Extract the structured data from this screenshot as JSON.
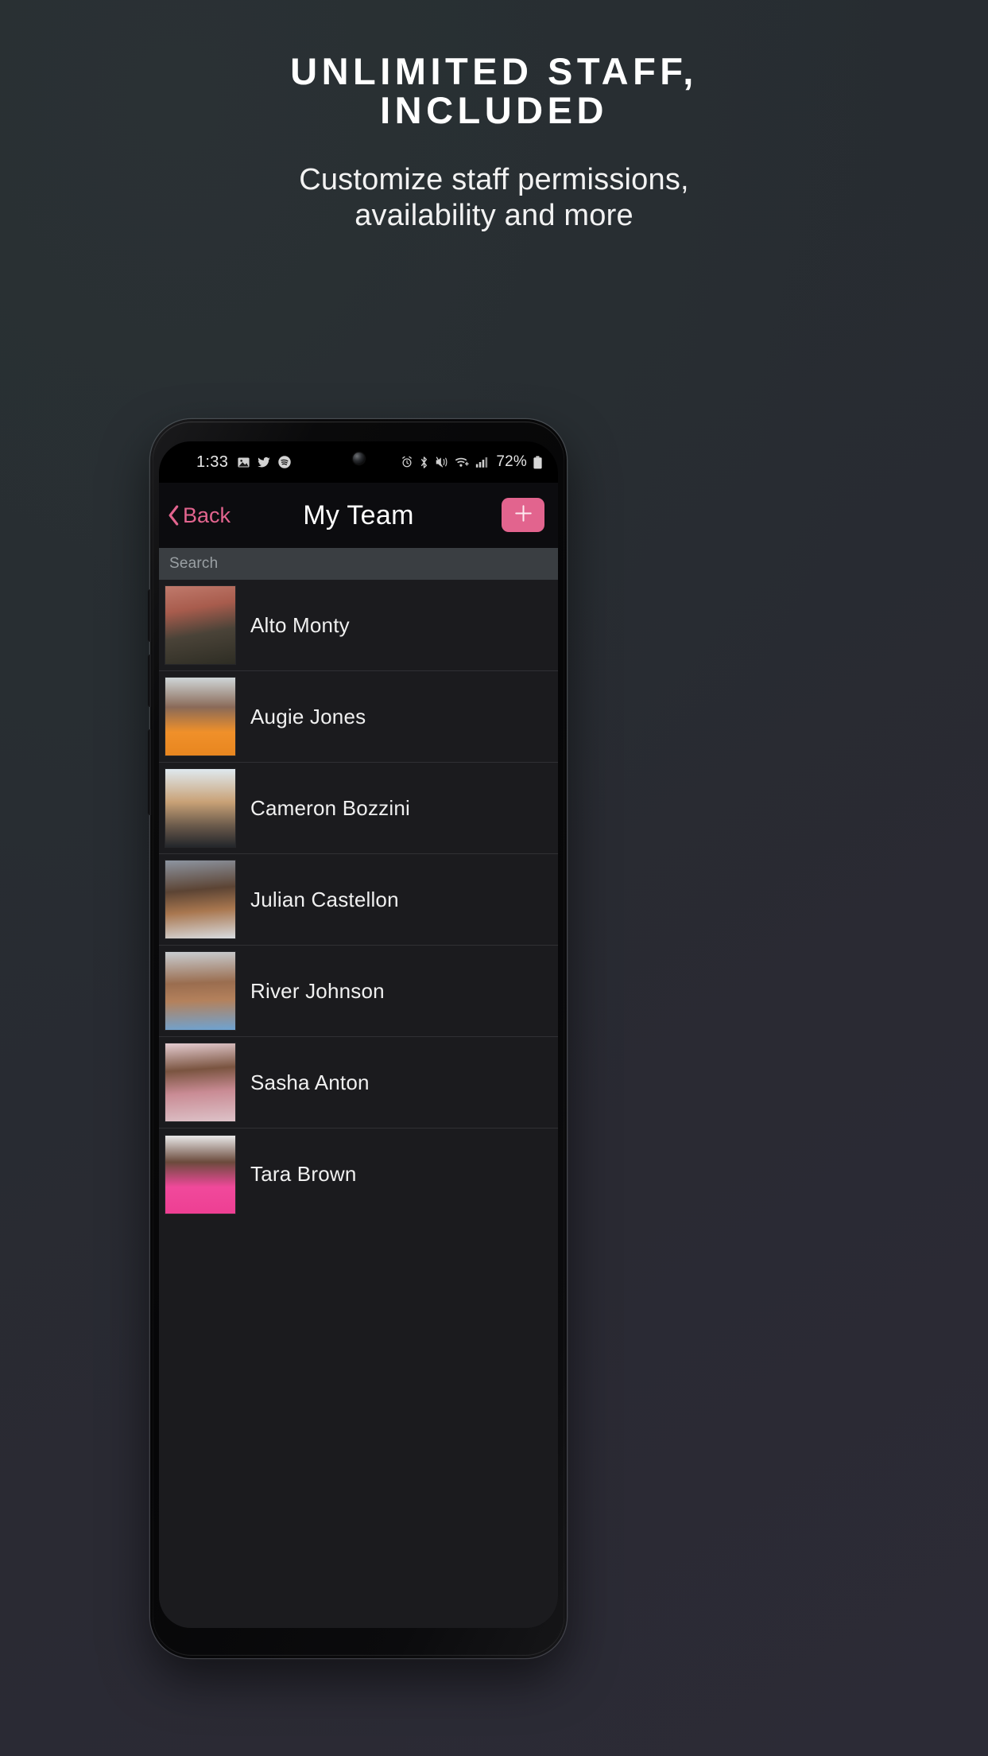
{
  "promo": {
    "headline_line1": "UNLIMITED STAFF,",
    "headline_line2": "INCLUDED",
    "subhead_line1": "Customize staff permissions,",
    "subhead_line2": "availability and more"
  },
  "colors": {
    "accent_pink": "#E2648E",
    "bg_top_left": "#262D30",
    "bg_bottom_right": "#2B2B35",
    "screen_bg": "#1B1B1E",
    "navbar_bg": "#0C0C0F",
    "search_bg": "#3A3E42",
    "divider": "#303034"
  },
  "statusbar": {
    "time": "1:33",
    "battery_percent": "72%",
    "left_icons": [
      "photos-icon",
      "twitter-icon",
      "spotify-icon"
    ],
    "right_icons": [
      "alarm-icon",
      "bluetooth-icon",
      "mute-vibrate-icon",
      "wifi-icon",
      "cellular-signal-icon",
      "battery-icon"
    ]
  },
  "navbar": {
    "back_label": "Back",
    "title": "My Team",
    "add_label": "+"
  },
  "search": {
    "placeholder": "Search",
    "value": ""
  },
  "staff": {
    "rows": [
      {
        "name": "Alto Monty",
        "avatar_bg": "linear-gradient(170deg,#c07a6c 0%,#a85c4d 30%,#4a4338 60%,#2e2d24 100%)"
      },
      {
        "name": "Augie Jones",
        "avatar_bg": "linear-gradient(180deg,#cfd6d8 0%,#8a6a58 38%,#f0902a 70%,#e8861f 100%)"
      },
      {
        "name": "Cameron Bozzini",
        "avatar_bg": "linear-gradient(180deg,#dfe9ef 0%,#c9a277 42%,#6d5c4c 72%,#23262b 100%)"
      },
      {
        "name": "Julian Castellon",
        "avatar_bg": "linear-gradient(175deg,#8d95a1 0%,#5c4434 38%,#a9774f 64%,#d8dce0 100%)"
      },
      {
        "name": "River Johnson",
        "avatar_bg": "linear-gradient(178deg,#c9cdd1 0%,#9a6d4f 40%,#b4815c 62%,#6ea3d2 100%)"
      },
      {
        "name": "Sasha Anton",
        "avatar_bg": "linear-gradient(176deg,#e6cdd2 0%,#7a5440 34%,#c98b94 62%,#ddc2c8 100%)"
      },
      {
        "name": "Tara Brown",
        "avatar_bg": "linear-gradient(180deg,#e9e9e9 0%,#6b4a3c 34%,#f0499b 66%,#ee3f93 100%)"
      }
    ]
  }
}
